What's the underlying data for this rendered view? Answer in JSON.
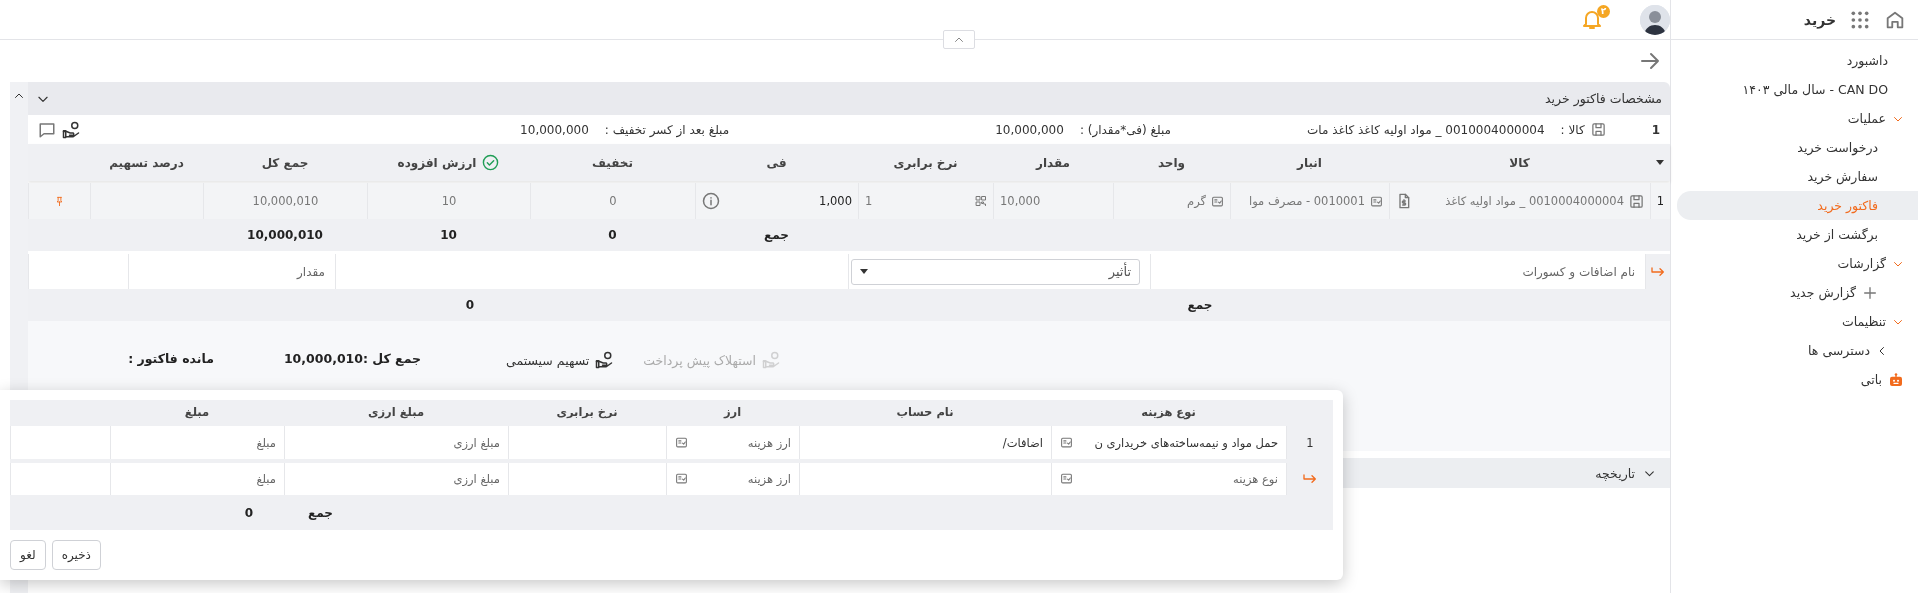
{
  "header": {
    "app_title": "خرید",
    "notification_count": "۲"
  },
  "sidebar": {
    "items": [
      {
        "kind": "link",
        "label": "داشبورد",
        "selected": false
      },
      {
        "kind": "link",
        "label": "CAN DO - سال مالی ۱۴۰۳",
        "selected": false
      },
      {
        "kind": "group",
        "label": "عملیات",
        "expanded": true,
        "children": [
          {
            "kind": "link",
            "label": "درخواست خرید",
            "selected": false
          },
          {
            "kind": "link",
            "label": "سفارش خرید",
            "selected": false
          },
          {
            "kind": "link",
            "label": "فاکتور خرید",
            "selected": true
          },
          {
            "kind": "link",
            "label": "برگشت از خرید",
            "selected": false
          }
        ]
      },
      {
        "kind": "group",
        "label": "گزارشات",
        "expanded": true,
        "children": [
          {
            "kind": "add",
            "label": "گزارش جدید"
          }
        ]
      },
      {
        "kind": "group",
        "label": "تنظیمات",
        "expanded": true,
        "children": [
          {
            "kind": "group",
            "label": "دسترسی ها",
            "expanded": false
          }
        ]
      },
      {
        "kind": "bot",
        "label": "باتی"
      }
    ]
  },
  "panel": {
    "title": "مشخصات فاکتور خرید",
    "expanded": true,
    "summary": {
      "row_number": "1",
      "item_label": "کالا :",
      "item_value": "0010004000004 _ مواد اولیه کاغذ کاغذ مات",
      "amount_label": "مبلغ (فی*مقدار) :",
      "amount_value": "10,000,000",
      "net_label": "مبلغ بعد از کسر تخفیف :",
      "net_value": "10,000,000"
    },
    "items_table": {
      "columns": [
        {
          "label": "کالا"
        },
        {
          "label": "انبار"
        },
        {
          "label": "واحد"
        },
        {
          "label": "مقدار"
        },
        {
          "label": "نرخ برابری"
        },
        {
          "label": "فی"
        },
        {
          "label": "تخفیف"
        },
        {
          "label": "ارزش افزوده",
          "checked": true
        },
        {
          "label": "جمع کل"
        },
        {
          "label": "درصد تسهیم"
        }
      ],
      "rows": [
        {
          "number": "1",
          "item": "0010004000004 _ مواد اولیه کاغذ",
          "warehouse": "0010001 - مصرف موا",
          "unit": "گرم",
          "quantity": "10,000",
          "rate": "1",
          "price": "1,000",
          "discount": "0",
          "vat": "10",
          "total": "10,000,010"
        }
      ],
      "totals": {
        "label": "جمع",
        "discount": "0",
        "vat": "10",
        "total": "10,000,010"
      }
    },
    "additions": {
      "name_placeholder": "نام اضافات و کسورات",
      "effect_placeholder": "تأثیر",
      "amount_placeholder": "مقدار",
      "total_label": "جمع",
      "total_value": "0"
    },
    "footer": [
      {
        "kind": "action",
        "label": "استهلاک پیش پرداخت",
        "disabled": true
      },
      {
        "kind": "action",
        "label": "تسهیم سیستمی",
        "disabled": false
      },
      {
        "kind": "total",
        "label": "جمع کل :10,000,010"
      },
      {
        "kind": "total",
        "label": "مانده فاکتور :"
      }
    ],
    "history": {
      "label": "تاریخچه",
      "expanded": false
    }
  },
  "dialog": {
    "columns": [
      "نوع هزینه",
      "نام حساب",
      "ارز",
      "نرخ برابری",
      "مبلغ ارزی",
      "مبلغ"
    ],
    "rows": [
      {
        "kind": "saved",
        "number": "1",
        "cost_type": "حمل مواد و نیمه‌ساخته‌های خریداری ن",
        "account": "اضافات/",
        "currency_placeholder": "ارز هزینه",
        "fx_amount_placeholder": "مبلغ ارزی",
        "amount_placeholder": "مبلغ"
      },
      {
        "kind": "new",
        "cost_type_placeholder": "نوع هزینه",
        "currency_placeholder": "ارز هزینه",
        "fx_amount_placeholder": "مبلغ ارزی",
        "amount_placeholder": "مبلغ"
      }
    ],
    "totals": {
      "label": "جمع",
      "value": "0"
    },
    "buttons": [
      "ذخیره",
      "لغو"
    ]
  }
}
